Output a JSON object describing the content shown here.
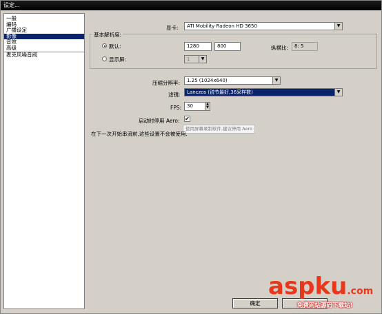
{
  "window": {
    "title": "设定..."
  },
  "sidebar": {
    "items": [
      {
        "label": "一般"
      },
      {
        "label": "编码"
      },
      {
        "label": "广播设定"
      },
      {
        "label": "影像"
      },
      {
        "label": "音效"
      },
      {
        "label": "高级"
      },
      {
        "label": "麦克风噪音阀"
      }
    ],
    "selected": "影像"
  },
  "video": {
    "adapter_label": "显卡:",
    "adapter_value": "ATI Mobility Radeon HD 3650",
    "base_res_group": "基本解析度:",
    "default_label": "默认:",
    "width": "1280",
    "height": "800",
    "aspect_label": "纵横比:",
    "aspect_value": "8: 5",
    "monitor_label": "显示屏:",
    "monitor_value": "1",
    "downscale_label": "压缩分辨率:",
    "downscale_value": "1.25 (1024x640)",
    "filter_label": "滤镜:",
    "filter_value": "Lanczos (锐节最好,36采样数)",
    "fps_label": "FPS:",
    "fps_value": "30",
    "aero_label": "启动时停用 Aero:",
    "aero_checked": true,
    "aero_tooltip": "使用屏幕录制软件,建议停用 Aero",
    "notice": "在下一次开始串流前,这些设置不会被使用."
  },
  "buttons": {
    "ok": "确定",
    "cancel": ""
  },
  "watermark": {
    "brand": "aspku",
    "tld": ".com",
    "tagline": "免费网站源码下载站!"
  }
}
